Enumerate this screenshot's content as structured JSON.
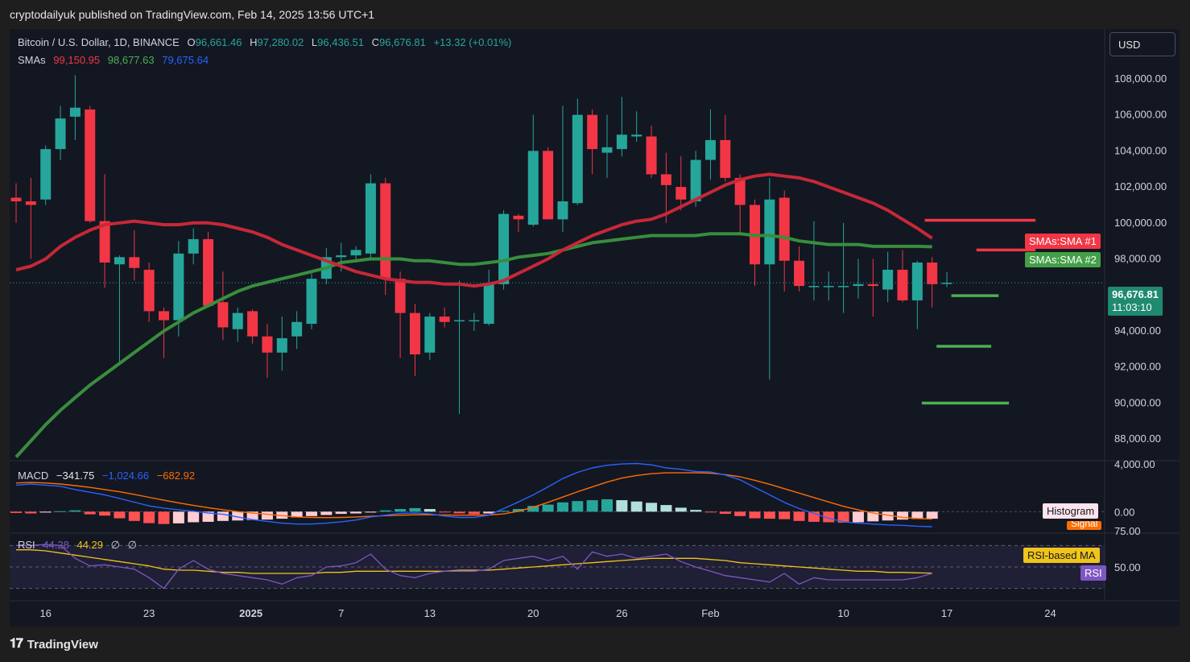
{
  "header": {
    "publisher_line": "cryptodailyuk published on TradingView.com, Feb 14, 2025 13:56 UTC+1"
  },
  "symbol": {
    "name": "Bitcoin / U.S. Dollar, 1D, BINANCE",
    "open_label": "O",
    "open": "96,661.46",
    "high_label": "H",
    "high": "97,280.02",
    "low_label": "L",
    "low": "96,436.51",
    "close_label": "C",
    "close": "96,676.81",
    "change": "+13.32 (+0.01%)"
  },
  "sma_legend": {
    "label": "SMAs",
    "sma1": "99,150.95",
    "sma2": "98,677.63",
    "sma3": "79,675.64"
  },
  "currency_button": "USD",
  "price_tags": {
    "sma1": "SMAs:SMA #1",
    "sma2": "SMAs:SMA #2",
    "last": "96,676.81",
    "countdown": "11:03:10"
  },
  "macd_legend": {
    "label": "MACD",
    "macd": "−341.75",
    "signal": "−1,024.66",
    "hist": "−682.92"
  },
  "macd_tags": {
    "histogram": "Histogram",
    "signal": "Signal"
  },
  "rsi_legend": {
    "label": "RSI",
    "rsi": "44.28",
    "ma": "44.29",
    "s1": "∅",
    "s2": "∅"
  },
  "rsi_tags": {
    "ma": "RSI-based MA",
    "rsi": "RSI"
  },
  "footer": {
    "brand": "TradingView"
  },
  "colors": {
    "up": "#26a69a",
    "down": "#f23645",
    "sma1": "#e0283c",
    "sma2": "#3d9a3d",
    "macd": "#2962ff",
    "signal": "#ff6d00",
    "rsi": "#7e57c2",
    "rsi_ma": "#f0c419"
  },
  "chart_data": [
    {
      "type": "candlestick",
      "title": "Bitcoin / U.S. Dollar, 1D, BINANCE",
      "ylim": [
        86800,
        110500
      ],
      "y_ticks": [
        "88,000.00",
        "90,000.00",
        "92,000.00",
        "94,000.00",
        "96,000.00",
        "98,000.00",
        "100,000.00",
        "102,000.00",
        "104,000.00",
        "106,000.00",
        "108,000.00"
      ],
      "x_ticks": [
        {
          "label": "16",
          "i": 2
        },
        {
          "label": "23",
          "i": 9
        },
        {
          "label": "2025",
          "i": 16
        },
        {
          "label": "7",
          "i": 22
        },
        {
          "label": "13",
          "i": 28
        },
        {
          "label": "20",
          "i": 35
        },
        {
          "label": "26",
          "i": 41
        },
        {
          "label": "Feb",
          "i": 47
        },
        {
          "label": "10",
          "i": 56
        },
        {
          "label": "17",
          "i": 63
        },
        {
          "label": "24",
          "i": 70
        }
      ],
      "candles": [
        {
          "o": 101400,
          "h": 102200,
          "l": 100000,
          "c": 101200
        },
        {
          "o": 101200,
          "h": 102500,
          "l": 98000,
          "c": 101000
        },
        {
          "o": 101300,
          "h": 104300,
          "l": 101000,
          "c": 104100
        },
        {
          "o": 104100,
          "h": 106500,
          "l": 103500,
          "c": 105800
        },
        {
          "o": 105900,
          "h": 108200,
          "l": 104600,
          "c": 106400
        },
        {
          "o": 106300,
          "h": 106500,
          "l": 100000,
          "c": 100100
        },
        {
          "o": 100100,
          "h": 102700,
          "l": 96400,
          "c": 97800
        },
        {
          "o": 97700,
          "h": 98200,
          "l": 92200,
          "c": 98100
        },
        {
          "o": 98100,
          "h": 99600,
          "l": 96800,
          "c": 97500
        },
        {
          "o": 97400,
          "h": 97800,
          "l": 94500,
          "c": 95100
        },
        {
          "o": 95100,
          "h": 95300,
          "l": 92500,
          "c": 94600
        },
        {
          "o": 94600,
          "h": 99000,
          "l": 93700,
          "c": 98300
        },
        {
          "o": 98300,
          "h": 99700,
          "l": 97700,
          "c": 99100
        },
        {
          "o": 99100,
          "h": 99500,
          "l": 95500,
          "c": 95400
        },
        {
          "o": 95600,
          "h": 97300,
          "l": 93500,
          "c": 94200
        },
        {
          "o": 94100,
          "h": 95300,
          "l": 93400,
          "c": 95000
        },
        {
          "o": 95100,
          "h": 95200,
          "l": 93300,
          "c": 93700
        },
        {
          "o": 93700,
          "h": 94400,
          "l": 91400,
          "c": 92800
        },
        {
          "o": 92800,
          "h": 94800,
          "l": 91800,
          "c": 93600
        },
        {
          "o": 93700,
          "h": 95100,
          "l": 93000,
          "c": 94500
        },
        {
          "o": 94400,
          "h": 97200,
          "l": 94100,
          "c": 96900
        },
        {
          "o": 96900,
          "h": 98600,
          "l": 96600,
          "c": 98100
        },
        {
          "o": 98100,
          "h": 98900,
          "l": 97300,
          "c": 98200
        },
        {
          "o": 98200,
          "h": 98700,
          "l": 97800,
          "c": 98500
        },
        {
          "o": 98300,
          "h": 102700,
          "l": 97900,
          "c": 102200
        },
        {
          "o": 102200,
          "h": 102500,
          "l": 96000,
          "c": 96900
        },
        {
          "o": 96900,
          "h": 97300,
          "l": 92500,
          "c": 95000
        },
        {
          "o": 95000,
          "h": 95500,
          "l": 91500,
          "c": 92700
        },
        {
          "o": 92800,
          "h": 95000,
          "l": 92400,
          "c": 94800
        },
        {
          "o": 94800,
          "h": 95300,
          "l": 94200,
          "c": 94500
        },
        {
          "o": 94600,
          "h": 96800,
          "l": 89400,
          "c": 94600
        },
        {
          "o": 94600,
          "h": 95000,
          "l": 94000,
          "c": 94600
        },
        {
          "o": 94400,
          "h": 97400,
          "l": 94300,
          "c": 96600
        },
        {
          "o": 96600,
          "h": 100700,
          "l": 96300,
          "c": 100500
        },
        {
          "o": 100400,
          "h": 100500,
          "l": 99500,
          "c": 100200
        },
        {
          "o": 99900,
          "h": 106000,
          "l": 99800,
          "c": 104000
        },
        {
          "o": 104000,
          "h": 104200,
          "l": 100300,
          "c": 100200
        },
        {
          "o": 100200,
          "h": 106500,
          "l": 99500,
          "c": 101200
        },
        {
          "o": 101100,
          "h": 106900,
          "l": 101000,
          "c": 106000
        },
        {
          "o": 106000,
          "h": 106300,
          "l": 102700,
          "c": 104100
        },
        {
          "o": 103900,
          "h": 106000,
          "l": 102500,
          "c": 104200
        },
        {
          "o": 104100,
          "h": 107000,
          "l": 103700,
          "c": 104900
        },
        {
          "o": 104800,
          "h": 106200,
          "l": 104500,
          "c": 104900
        },
        {
          "o": 104800,
          "h": 105400,
          "l": 102500,
          "c": 102700
        },
        {
          "o": 102700,
          "h": 103900,
          "l": 100000,
          "c": 102100
        },
        {
          "o": 102000,
          "h": 103700,
          "l": 100700,
          "c": 101300
        },
        {
          "o": 101200,
          "h": 104000,
          "l": 100900,
          "c": 103500
        },
        {
          "o": 103500,
          "h": 106300,
          "l": 102400,
          "c": 104600
        },
        {
          "o": 104600,
          "h": 106000,
          "l": 102300,
          "c": 102500
        },
        {
          "o": 102500,
          "h": 102700,
          "l": 99300,
          "c": 101000
        },
        {
          "o": 101000,
          "h": 101300,
          "l": 96500,
          "c": 97700
        },
        {
          "o": 97700,
          "h": 102500,
          "l": 91300,
          "c": 101300
        },
        {
          "o": 101400,
          "h": 101800,
          "l": 96200,
          "c": 97900
        },
        {
          "o": 97900,
          "h": 98700,
          "l": 96200,
          "c": 96500
        },
        {
          "o": 96500,
          "h": 100100,
          "l": 95700,
          "c": 96500
        },
        {
          "o": 96500,
          "h": 97300,
          "l": 95700,
          "c": 96500
        },
        {
          "o": 96500,
          "h": 100000,
          "l": 95000,
          "c": 96500
        },
        {
          "o": 96500,
          "h": 98000,
          "l": 95800,
          "c": 96600
        },
        {
          "o": 96600,
          "h": 98000,
          "l": 94800,
          "c": 96500
        },
        {
          "o": 96300,
          "h": 98400,
          "l": 95600,
          "c": 97400
        },
        {
          "o": 97400,
          "h": 98500,
          "l": 95600,
          "c": 95700
        },
        {
          "o": 95700,
          "h": 97900,
          "l": 94100,
          "c": 97800
        },
        {
          "o": 97800,
          "h": 98100,
          "l": 95300,
          "c": 96600
        },
        {
          "o": 96661.46,
          "h": 97280.02,
          "l": 96436.51,
          "c": 96676.81
        }
      ],
      "sma1": [
        97400,
        97600,
        98000,
        98700,
        99200,
        99600,
        99900,
        100000,
        100100,
        100000,
        99900,
        99900,
        100000,
        100000,
        99900,
        99700,
        99500,
        99200,
        98800,
        98500,
        98200,
        97900,
        97600,
        97300,
        97100,
        96900,
        96800,
        96700,
        96700,
        96600,
        96600,
        96500,
        96600,
        96800,
        97200,
        97600,
        98000,
        98500,
        98900,
        99300,
        99600,
        99900,
        100100,
        100200,
        100500,
        100900,
        101300,
        101700,
        102100,
        102400,
        102600,
        102700,
        102600,
        102500,
        102300,
        102000,
        101700,
        101400,
        101100,
        100700,
        100200,
        99700,
        99150.95
      ],
      "sma2": [
        87000,
        87900,
        88800,
        89600,
        90300,
        91000,
        91600,
        92200,
        92800,
        93400,
        94000,
        94500,
        95000,
        95400,
        95800,
        96200,
        96500,
        96700,
        96900,
        97100,
        97300,
        97500,
        97800,
        97900,
        98000,
        98000,
        98000,
        97900,
        97900,
        97800,
        97700,
        97700,
        97800,
        97900,
        98100,
        98200,
        98300,
        98500,
        98700,
        98900,
        99000,
        99100,
        99200,
        99300,
        99300,
        99300,
        99300,
        99400,
        99400,
        99400,
        99300,
        99300,
        99200,
        99000,
        98900,
        98800,
        98800,
        98800,
        98700,
        98700,
        98700,
        98700,
        98677.63
      ],
      "hlines": [
        {
          "y": 100150,
          "from": 61.5,
          "to": 69,
          "color": "#f23645",
          "label": "SMAs:SMA #1"
        },
        {
          "y": 98500,
          "from": 65,
          "to": 69,
          "color": "#f23645",
          "label": "SMAs:SMA #2"
        },
        {
          "y": 95960,
          "from": 63.3,
          "to": 66.5,
          "color": "#4caf50"
        },
        {
          "y": 93150,
          "from": 62.3,
          "to": 66,
          "color": "#4caf50"
        },
        {
          "y": 90000,
          "from": 61.3,
          "to": 67.2,
          "color": "#4caf50"
        }
      ],
      "last_price": 96676.81
    },
    {
      "type": "bar",
      "title": "MACD",
      "ylim": [
        -900,
        2200
      ],
      "y_ticks": [
        "4,000.00",
        "0.00"
      ],
      "histogram": [
        -60,
        -80,
        -40,
        20,
        60,
        -120,
        -180,
        -300,
        -420,
        -520,
        -560,
        -530,
        -480,
        -460,
        -420,
        -400,
        -380,
        -360,
        -320,
        -260,
        -200,
        -150,
        -100,
        -80,
        -40,
        60,
        120,
        160,
        120,
        -20,
        -80,
        -120,
        -80,
        40,
        120,
        260,
        320,
        420,
        480,
        520,
        560,
        520,
        460,
        400,
        300,
        180,
        80,
        -20,
        -100,
        -200,
        -300,
        -320,
        -340,
        -420,
        -460,
        -480,
        -500,
        -480,
        -440,
        -400,
        -360,
        -330,
        -320
      ],
      "macd": [
        1200,
        1250,
        1200,
        1150,
        1000,
        880,
        760,
        600,
        430,
        260,
        160,
        80,
        20,
        -60,
        -120,
        -240,
        -360,
        -440,
        -520,
        -560,
        -560,
        -520,
        -460,
        -380,
        -240,
        -160,
        -80,
        -60,
        -100,
        -200,
        -260,
        -260,
        -160,
        140,
        440,
        760,
        1120,
        1500,
        1780,
        1980,
        2100,
        2160,
        2180,
        2120,
        1980,
        1920,
        1820,
        1800,
        1660,
        1440,
        1100,
        760,
        420,
        140,
        -80,
        -300,
        -460,
        -520,
        -560,
        -600,
        -620,
        -660,
        -680
      ],
      "signal": [
        1300,
        1320,
        1300,
        1250,
        1180,
        1100,
        1000,
        900,
        780,
        650,
        520,
        400,
        280,
        180,
        90,
        0,
        -60,
        -120,
        -180,
        -240,
        -260,
        -270,
        -260,
        -240,
        -210,
        -180,
        -160,
        -140,
        -140,
        -150,
        -160,
        -160,
        -150,
        -100,
        20,
        200,
        420,
        660,
        900,
        1120,
        1340,
        1520,
        1640,
        1720,
        1760,
        1760,
        1760,
        1740,
        1680,
        1580,
        1420,
        1240,
        1040,
        840,
        640,
        440,
        240,
        80,
        -60,
        -160,
        -260,
        -310,
        -340
      ]
    },
    {
      "type": "line",
      "title": "RSI",
      "ylim": [
        20,
        80
      ],
      "y_ticks": [
        "75.00",
        "50.00"
      ],
      "rsi": [
        70,
        70,
        71,
        70,
        58,
        51,
        52,
        50,
        48,
        40,
        30,
        48,
        56,
        48,
        44,
        42,
        40,
        38,
        34,
        40,
        42,
        50,
        51,
        54,
        62,
        48,
        42,
        40,
        44,
        46,
        46,
        46,
        48,
        56,
        58,
        60,
        56,
        60,
        48,
        64,
        60,
        62,
        58,
        60,
        62,
        55,
        50,
        46,
        42,
        40,
        38,
        36,
        44,
        34,
        40,
        38,
        38,
        38,
        38,
        38,
        38,
        40,
        44
      ],
      "rsi_ma": [
        66,
        66,
        65,
        63,
        61,
        59,
        57,
        55,
        53,
        51,
        48,
        47,
        47,
        46,
        45,
        45,
        44,
        44,
        44,
        44,
        44,
        45,
        45,
        46,
        46,
        46,
        46,
        46,
        46,
        46,
        47,
        47,
        47,
        48,
        49,
        50,
        51,
        52,
        53,
        54,
        55,
        56,
        57,
        58,
        58,
        58,
        58,
        57,
        56,
        54,
        53,
        52,
        51,
        50,
        49,
        48,
        47,
        46,
        46,
        45,
        45,
        44.5,
        44.29
      ]
    }
  ]
}
